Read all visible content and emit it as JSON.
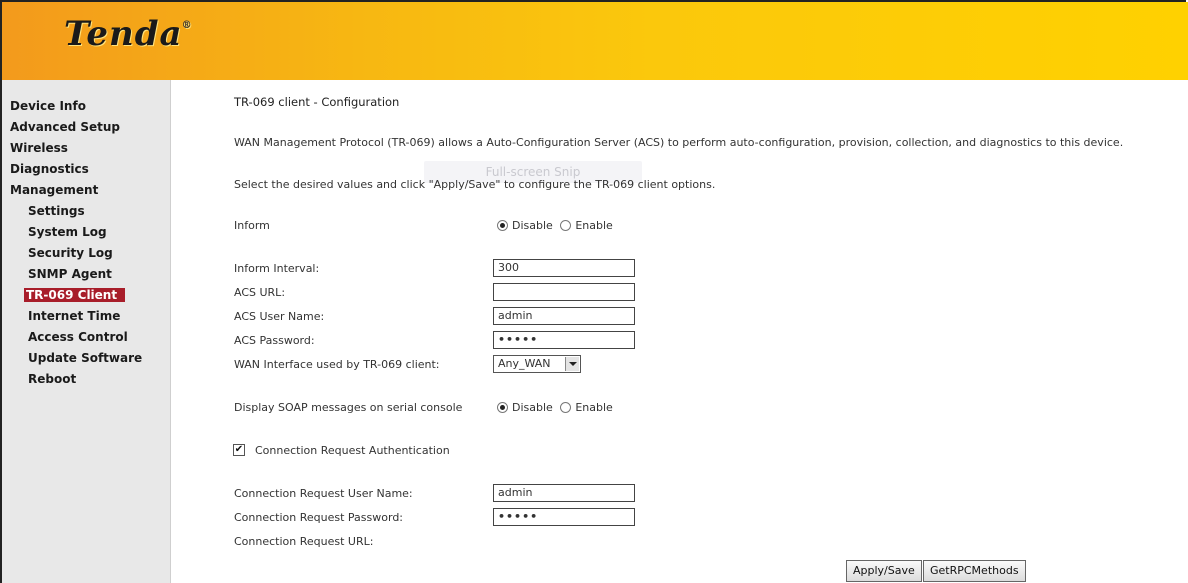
{
  "brand": {
    "logo_text": "Tenda",
    "logo_mark": "®"
  },
  "sidebar": {
    "items": [
      {
        "label": "Device Info",
        "level": "top"
      },
      {
        "label": "Advanced Setup",
        "level": "top"
      },
      {
        "label": "Wireless",
        "level": "top"
      },
      {
        "label": "Diagnostics",
        "level": "top"
      },
      {
        "label": "Management",
        "level": "top"
      },
      {
        "label": "Settings",
        "level": "sub"
      },
      {
        "label": "System Log",
        "level": "sub"
      },
      {
        "label": "Security Log",
        "level": "sub"
      },
      {
        "label": "SNMP Agent",
        "level": "sub"
      },
      {
        "label": "TR-069 Client",
        "level": "sub",
        "active": true
      },
      {
        "label": "Internet Time",
        "level": "sub"
      },
      {
        "label": "Access Control",
        "level": "sub"
      },
      {
        "label": "Update Software",
        "level": "sub"
      },
      {
        "label": "Reboot",
        "level": "sub"
      }
    ]
  },
  "page": {
    "title": "TR-069 client - Configuration",
    "description": "WAN Management Protocol (TR-069) allows a Auto-Configuration Server (ACS) to perform auto-configuration, provision, collection, and diagnostics to this device.",
    "instruction": "Select the desired values and click \"Apply/Save\" to configure the TR-069 client options.",
    "overlay_text": "Full-screen Snip"
  },
  "form": {
    "inform": {
      "label": "Inform",
      "disable": "Disable",
      "enable": "Enable",
      "selected": "Disable"
    },
    "inform_interval": {
      "label": "Inform Interval:",
      "value": "300"
    },
    "acs_url": {
      "label": "ACS URL:",
      "value": ""
    },
    "acs_user": {
      "label": "ACS User Name:",
      "value": "admin"
    },
    "acs_password": {
      "label": "ACS Password:",
      "value": "•••••"
    },
    "wan_interface": {
      "label": "WAN Interface used by TR-069 client:",
      "value": "Any_WAN"
    },
    "soap": {
      "label": "Display SOAP messages on serial console",
      "disable": "Disable",
      "enable": "Enable",
      "selected": "Disable"
    },
    "conn_auth": {
      "label": "Connection Request Authentication",
      "checked": true
    },
    "conn_user": {
      "label": "Connection Request User Name:",
      "value": "admin"
    },
    "conn_password": {
      "label": "Connection Request Password:",
      "value": "•••••"
    },
    "conn_url": {
      "label": "Connection Request URL:",
      "value": ""
    }
  },
  "buttons": {
    "apply": "Apply/Save",
    "rpc": "GetRPCMethods"
  },
  "colors": {
    "header_start": "#f39a1c",
    "header_end": "#ffd100",
    "active_nav": "#a81d2a",
    "sidebar_bg": "#e8e8e8"
  }
}
